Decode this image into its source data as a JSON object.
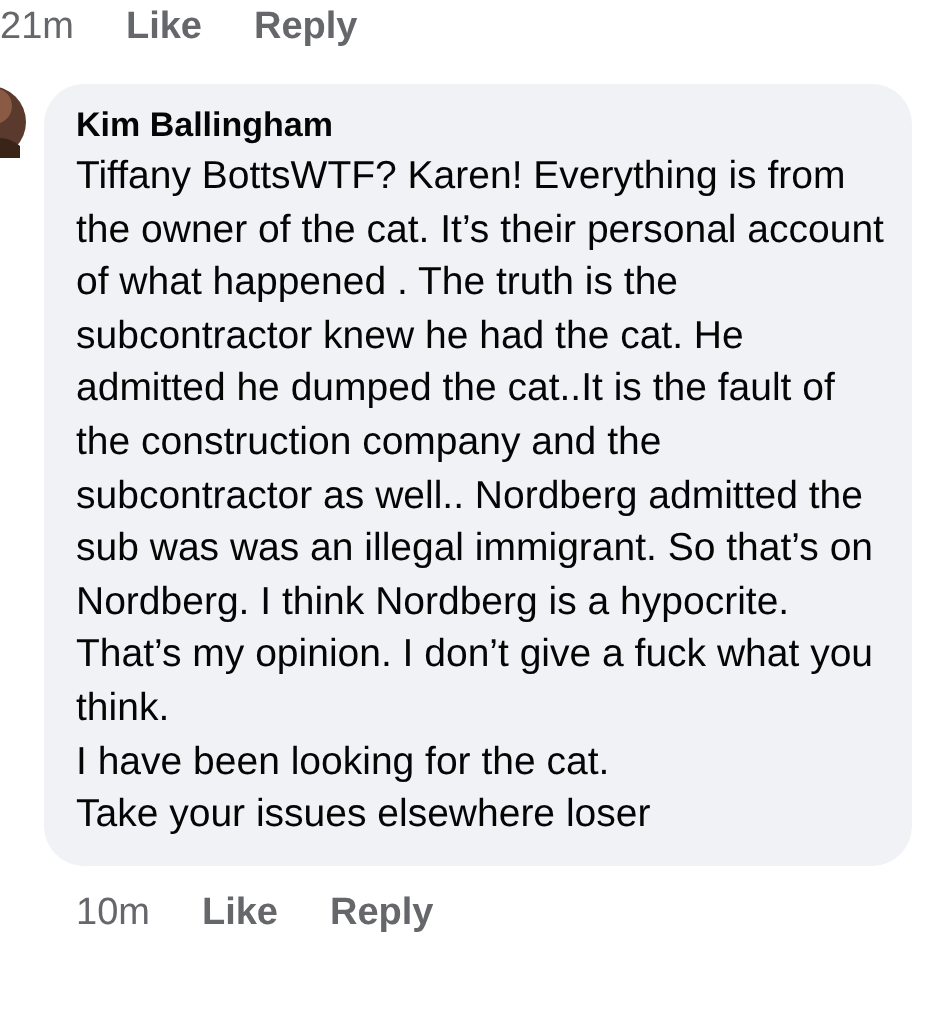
{
  "previous_comment_actions": {
    "time": "21m",
    "like": "Like",
    "reply": "Reply"
  },
  "comment": {
    "author": "Kim Ballingham",
    "paragraphs": [
      "Tiffany BottsWTF? Karen! Everything is from the owner of the cat. It’s their personal account of what happened . The truth is the subcontractor knew he had the cat. He admitted he dumped the cat..It is the fault of the construction company and the subcontractor as well.. Nordberg admitted the sub was was an illegal immigrant. So that’s on Nordberg. I think Nordberg is a hypocrite. That’s my opinion. I don’t give a fuck what you think.",
      "I have been looking for the cat.",
      "Take your issues elsewhere loser"
    ],
    "time": "10m",
    "like": "Like",
    "reply": "Reply"
  }
}
